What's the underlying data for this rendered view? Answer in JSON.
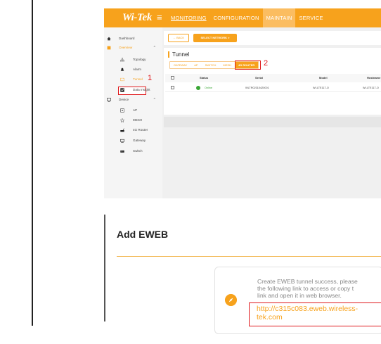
{
  "app": {
    "logo": "Wi-Tek",
    "top_nav": [
      "MONITORING",
      "CONFIGURATION",
      "MAINTAIN",
      "SERVICE"
    ]
  },
  "sidebar": {
    "dashboard": "Dashboard",
    "overview": "Overview",
    "items": [
      "Topology",
      "Alarm",
      "Tunnel",
      "Data Insight"
    ],
    "device": "Device",
    "device_items": [
      "AP",
      "MESH",
      "4G Router",
      "Gateway",
      "Switch"
    ]
  },
  "annotations": {
    "one": "1",
    "two": "2"
  },
  "toolbar": {
    "back": "← BACK",
    "select_network": "SELECT NETWORK  >"
  },
  "tunnel": {
    "title": "Tunnel",
    "tabs": [
      "GATEWAY",
      "AP",
      "SWITCH",
      "MESH",
      "4G ROUTER"
    ],
    "active_tab": "4G ROUTER",
    "columns": [
      "Status",
      "Serial",
      "Model",
      "Hostname"
    ],
    "rows": [
      {
        "status": "Online",
        "serial": "WLTR02310420001",
        "model": "WI-LTE117-O",
        "hostname": "WI-LTE117-O"
      }
    ]
  },
  "dialog": {
    "title": "Add EWEB",
    "message_lines": [
      "Create EWEB tunnel success, please",
      "the following link to access or copy t",
      "link and open it in web browser."
    ],
    "link_lines": [
      "http://c315c083.eweb.wireless-",
      "tek.com"
    ]
  },
  "colors": {
    "brand": "#f7a21c",
    "annotation": "#e0191c",
    "online": "#3aa635"
  }
}
